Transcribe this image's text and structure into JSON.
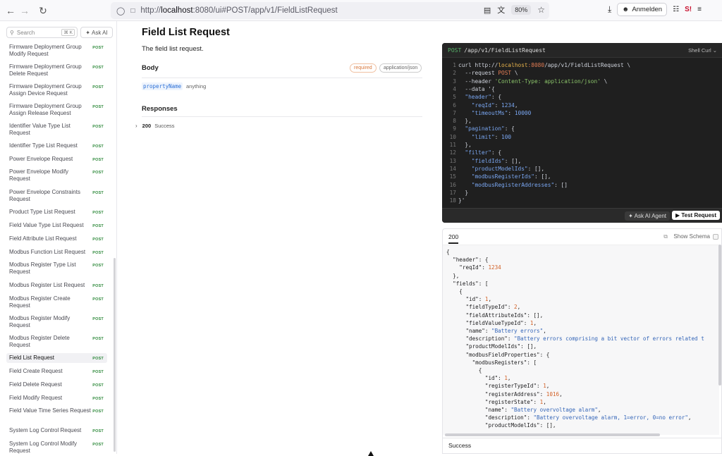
{
  "browser": {
    "url_prefix": "http://",
    "url_host": "localhost",
    "url_rest": ":8080/ui#POST/app/v1/FieldListRequest",
    "zoom": "80%",
    "signin_label": "Anmelden"
  },
  "sidebar": {
    "search_placeholder": "Search",
    "search_shortcut": "⌘ K",
    "ask_ai_label": "Ask AI",
    "method_badge": "POST",
    "items": [
      {
        "label": "Firmware Deployment Group Modify Request"
      },
      {
        "label": "Firmware Deployment Group Delete Request"
      },
      {
        "label": "Firmware Deployment Group Assign Device Request"
      },
      {
        "label": "Firmware Deployment Group Assign Release Request"
      },
      {
        "label": "Identifier Value Type List Request"
      },
      {
        "label": "Identifier Type List Request"
      },
      {
        "label": "Power Envelope Request"
      },
      {
        "label": "Power Envelope Modify Request"
      },
      {
        "label": "Power Envelope Constraints Request"
      },
      {
        "label": "Product Type List Request"
      },
      {
        "label": "Field Value Type List Request"
      },
      {
        "label": "Field Attribute List Request"
      },
      {
        "label": "Modbus Function List Request"
      },
      {
        "label": "Modbus Register Type List Request"
      },
      {
        "label": "Modbus Register List Request"
      },
      {
        "label": "Modbus Register Create Request"
      },
      {
        "label": "Modbus Register Modify Request"
      },
      {
        "label": "Modbus Register Delete Request"
      },
      {
        "label": "Field List Request"
      },
      {
        "label": "Field Create Request"
      },
      {
        "label": "Field Delete Request"
      },
      {
        "label": "Field Modify Request"
      },
      {
        "label": "Field Value Time Series Request"
      },
      {
        "label": "System Log Control Request"
      },
      {
        "label": "System Log Control Modify Request"
      }
    ],
    "active_label": "Field List Request"
  },
  "main": {
    "title": "Field List Request",
    "description": "The field list request.",
    "body_heading": "Body",
    "required_badge": "required",
    "content_type_badge": "application/json",
    "property_name": "propertyName",
    "property_type": "anything",
    "responses_heading": "Responses",
    "response_code": "200",
    "response_label": "Success"
  },
  "code_panel": {
    "method": "POST",
    "path": "/app/v1/FieldListRequest",
    "language": "Shell Curl",
    "ask_agent_label": "Ask AI Agent",
    "test_request_label": "Test Request",
    "lines": [
      "curl http://localhost:8080/app/v1/FieldListRequest \\",
      "  --request POST \\",
      "  --header 'Content-Type: application/json' \\",
      "  --data '{",
      "  \"header\": {",
      "    \"reqId\": 1234,",
      "    \"timeoutMs\": 10000",
      "  },",
      "  \"pagination\": {",
      "    \"limit\": 100",
      "  },",
      "  \"filter\": {",
      "    \"fieldIds\": [],",
      "    \"productModelIds\": [],",
      "    \"modbusRegisterIds\": [],",
      "    \"modbusRegisterAddresses\": []",
      "  }",
      "}'"
    ]
  },
  "response_panel": {
    "tab": "200",
    "show_schema_label": "Show Schema",
    "footer": "Success",
    "lines": [
      "{",
      "  \"header\": {",
      "    \"reqId\": 1234",
      "  },",
      "  \"fields\": [",
      "    {",
      "      \"id\": 1,",
      "      \"fieldTypeId\": 2,",
      "      \"fieldAttributeIds\": [],",
      "      \"fieldValueTypeId\": 1,",
      "      \"name\": \"Battery errors\",",
      "      \"description\": \"Battery errors comprising a bit vector of errors related t",
      "      \"productModelIds\": [],",
      "      \"modbusFieldProperties\": {",
      "        \"modbusRegisters\": [",
      "          {",
      "            \"id\": 1,",
      "            \"registerTypeId\": 1,",
      "            \"registerAddress\": 1016,",
      "            \"registerState\": 1,",
      "            \"name\": \"Battery overvoltage alarm\",",
      "            \"description\": \"Battery overvoltage alarm, 1=error, 0=no error\",",
      "            \"productModelIds\": [],"
    ]
  }
}
